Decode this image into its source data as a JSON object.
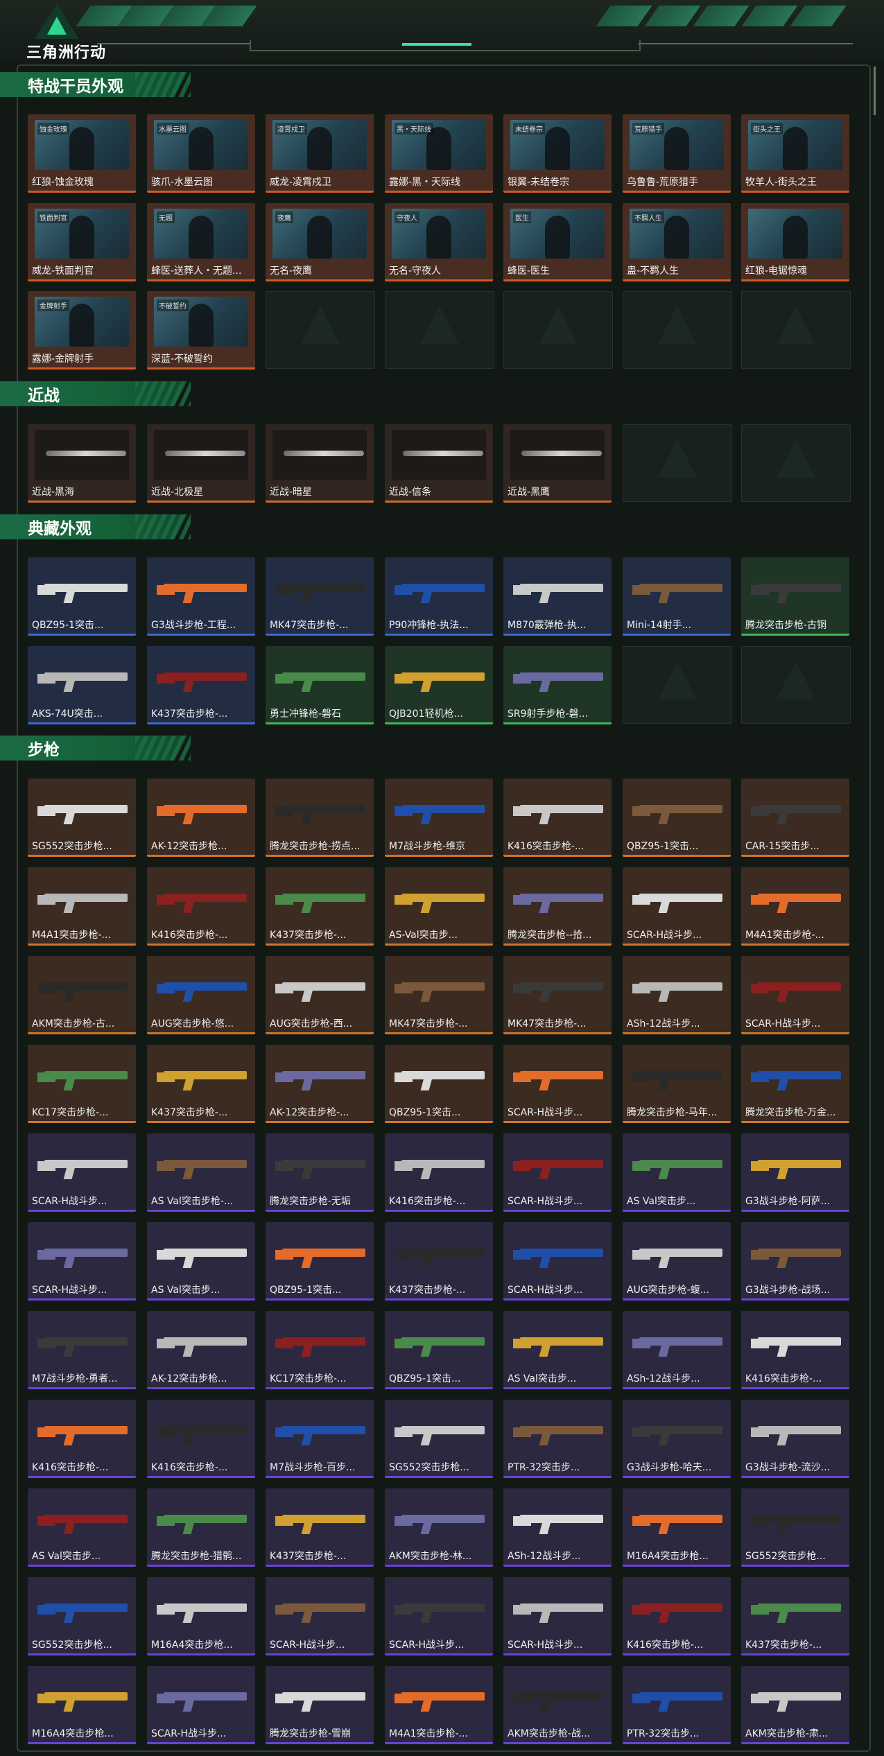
{
  "app": {
    "title": "三角洲行动"
  },
  "sections": {
    "agents": {
      "title": "特战干员外观",
      "items": [
        "红狼-蚀金玫瑰",
        "骇爪-水墨云图",
        "威龙-凌霄戍卫",
        "露娜-黑・天际线",
        "银翼-未结卷宗",
        "乌鲁鲁-荒原猎手",
        "牧羊人-街头之王",
        "威龙-铁面判官",
        "蜂医-送葬人・无题...",
        "无名-夜鹰",
        "无名-守夜人",
        "蜂医-医生",
        "蛊-不羁人生",
        "红狼-电锯惊魂",
        "露娜-金牌射手",
        "深蓝-不破誓约"
      ],
      "tags": [
        "蚀金玫瑰",
        "水墨云图",
        "凌霄戍卫",
        "黑・天际线",
        "未结卷宗",
        "荒原猎手",
        "街头之王",
        "铁面判官",
        "无题",
        "夜鹰",
        "守夜人",
        "医生",
        "不羁人生",
        "",
        "金牌射手",
        "不破誓约"
      ]
    },
    "melee": {
      "title": "近战",
      "items": [
        "近战-黑海",
        "近战-北极星",
        "近战-暗星",
        "近战-信条",
        "近战-黑鹰"
      ]
    },
    "collection": {
      "title": "典藏外观",
      "items": [
        "QBZ95-1突击...",
        "G3战斗步枪-工程...",
        "MK47突击步枪-...",
        "P90冲锋枪-执法...",
        "M870霰弹枪-执...",
        "Mini-14射手...",
        "腾龙突击步枪-古铜",
        "AKS-74U突击...",
        "K437突击步枪-...",
        "勇士冲锋枪-磐石",
        "QJB201轻机枪...",
        "SR9射手步枪-磐..."
      ]
    },
    "rifles": {
      "title": "步枪",
      "items": [
        "SG552突击步枪...",
        "AK-12突击步枪...",
        "腾龙突击步枪-捞点...",
        "M7战斗步枪-维京",
        "K416突击步枪-...",
        "QBZ95-1突击...",
        "CAR-15突击步...",
        "M4A1突击步枪-...",
        "K416突击步枪-...",
        "K437突击步枪-...",
        "AS-Val突击步...",
        "腾龙突击步枪--拾...",
        "SCAR-H战斗步...",
        "M4A1突击步枪-...",
        "AKM突击步枪-古...",
        "AUG突击步枪-悠...",
        "AUG突击步枪-西...",
        "MK47突击步枪-...",
        "MK47突击步枪-...",
        "ASh-12战斗步...",
        "SCAR-H战斗步...",
        "KC17突击步枪-...",
        "K437突击步枪-...",
        "AK-12突击步枪-...",
        "QBZ95-1突击...",
        "SCAR-H战斗步...",
        "腾龙突击步枪-马年...",
        "腾龙突击步枪-万金...",
        "SCAR-H战斗步...",
        "AS Val突击步枪-...",
        "腾龙突击步枪-无垢",
        "K416突击步枪-...",
        "SCAR-H战斗步...",
        "AS Val突击步...",
        "G3战斗步枪-阿萨...",
        "SCAR-H战斗步...",
        "AS Val突击步...",
        "QBZ95-1突击...",
        "K437突击步枪-...",
        "SCAR-H战斗步...",
        "AUG突击步枪-蝮...",
        "G3战斗步枪-战场...",
        "M7战斗步枪-勇者...",
        "AK-12突击步枪...",
        "KC17突击步枪-...",
        "QBZ95-1突击...",
        "AS Val突击步...",
        "ASh-12战斗步...",
        "K416突击步枪-...",
        "K416突击步枪-...",
        "K416突击步枪-...",
        "M7战斗步枪-百步...",
        "SG552突击步枪...",
        "PTR-32突击步...",
        "G3战斗步枪-哈夫...",
        "G3战斗步枪-流沙...",
        "AS Val突击步...",
        "腾龙突击步枪-猎鹘...",
        "K437突击步枪-...",
        "AKM突击步枪-林...",
        "ASh-12战斗步...",
        "M16A4突击步枪...",
        "SG552突击步枪...",
        "SG552突击步枪...",
        "M16A4突击步枪...",
        "SCAR-H战斗步...",
        "SCAR-H战斗步...",
        "SCAR-H战斗步...",
        "K416突击步枪-...",
        "K437突击步枪-...",
        "M16A4突击步枪...",
        "SCAR-H战斗步...",
        "腾龙突击步枪-雪崩",
        "M4A1突击步枪-...",
        "AKM突击步枪-战...",
        "PTR-32突击步...",
        "AKM突击步枪-肃..."
      ]
    }
  },
  "colors": {
    "accent": "#2fd58f",
    "section_bg": "#1b6b45",
    "orange_rarity": "#d07528",
    "purple_rarity": "#6a42d8",
    "blue_rarity": "#3d66d0",
    "green_rarity": "#3fb65f"
  },
  "icons": {
    "logo": "delta-triangle-logo",
    "empty_slot": "triangle-placeholder-icon"
  }
}
